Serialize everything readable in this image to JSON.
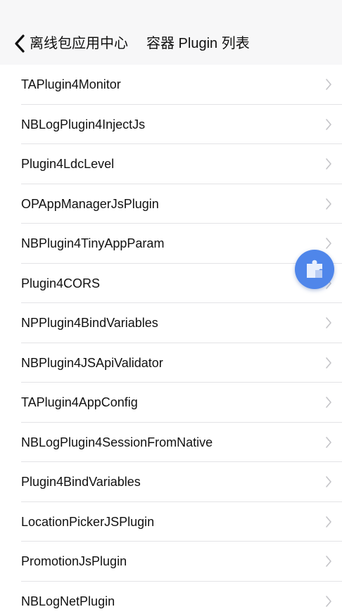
{
  "nav": {
    "back_label": "离线包应用中心",
    "title": "容器 Plugin 列表",
    "back_icon": "chevron-left-icon"
  },
  "plugins": [
    {
      "label": "TAPlugin4Monitor"
    },
    {
      "label": "NBLogPlugin4InjectJs"
    },
    {
      "label": "Plugin4LdcLevel"
    },
    {
      "label": "OPAppManagerJsPlugin"
    },
    {
      "label": "NBPlugin4TinyAppParam"
    },
    {
      "label": "Plugin4CORS"
    },
    {
      "label": "NPPlugin4BindVariables"
    },
    {
      "label": "NBPlugin4JSApiValidator"
    },
    {
      "label": "TAPlugin4AppConfig"
    },
    {
      "label": "NBLogPlugin4SessionFromNative"
    },
    {
      "label": "Plugin4BindVariables"
    },
    {
      "label": "LocationPickerJSPlugin"
    },
    {
      "label": "PromotionJsPlugin"
    },
    {
      "label": "NBLogNetPlugin"
    }
  ],
  "row_icon": "chevron-right-icon",
  "floating_button": {
    "icon": "puzzle-piece-icon",
    "color": "#4f86ea"
  },
  "colors": {
    "nav_background": "#f7f7f8",
    "separator": "#e3e3e6",
    "chevron": "#c4c4c8"
  }
}
